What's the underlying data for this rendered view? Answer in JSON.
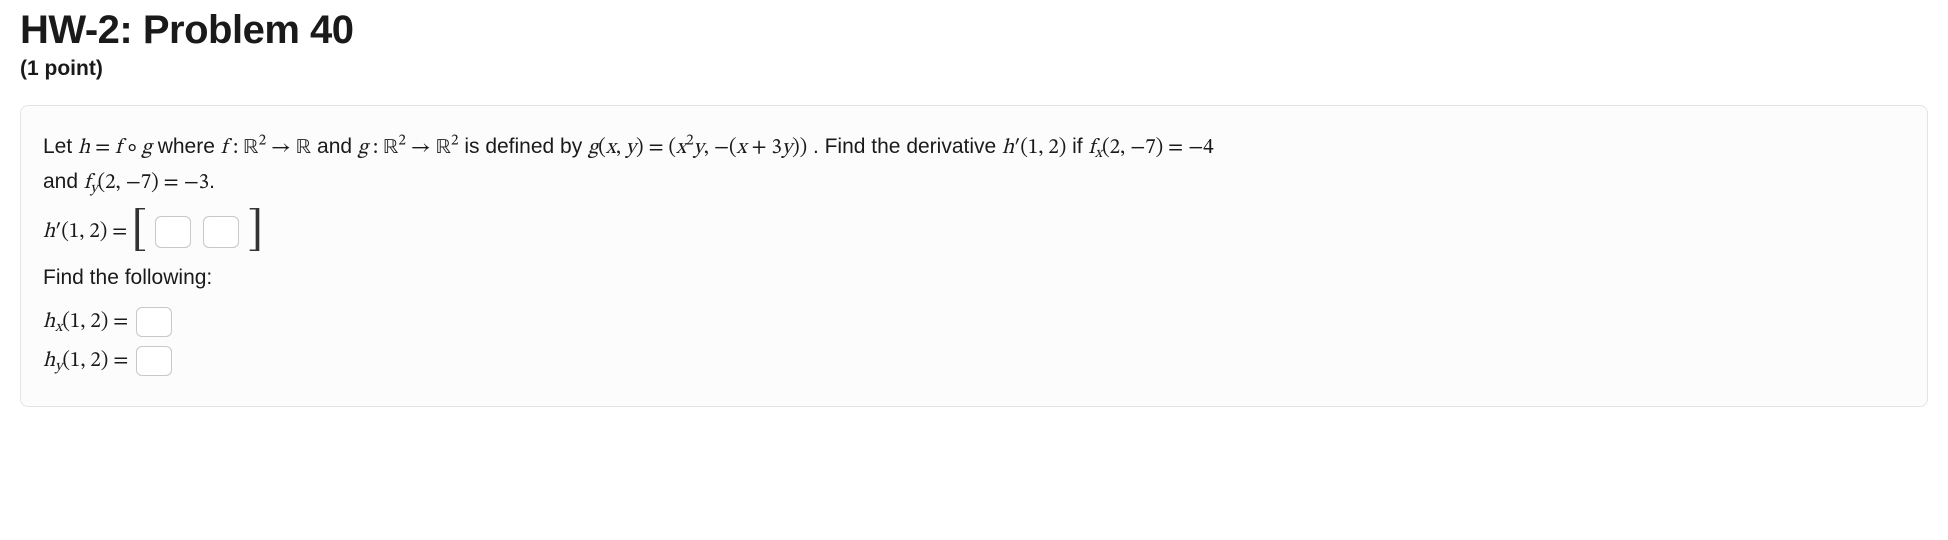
{
  "title": "HW-2: Problem 40",
  "points": "(1 point)",
  "problem": {
    "intro_a": "Let ",
    "math_h_eq": "h = f ∘ g",
    "intro_b": " where ",
    "math_fdom": "f : ℝ² → ℝ",
    "intro_c": " and ",
    "math_gdom": "g : ℝ² → ℝ²",
    "intro_d": " is defined by ",
    "math_gexpr": "g(x, y) = (x²y, −(x + 3y))",
    "intro_e": ". Find the derivative ",
    "math_hprime": "h′(1, 2)",
    "intro_f": " if ",
    "math_fx": "fₓ(2, −7) = −4",
    "intro_g": "and ",
    "math_fy": "f_y(2, −7) = −3",
    "intro_h": "."
  },
  "line_hprime_label": "h′(1, 2) = ",
  "find_following": "Find the following:",
  "line_hx_label": "hₓ(1, 2) = ",
  "line_hy_label": "h_y(1, 2) = "
}
